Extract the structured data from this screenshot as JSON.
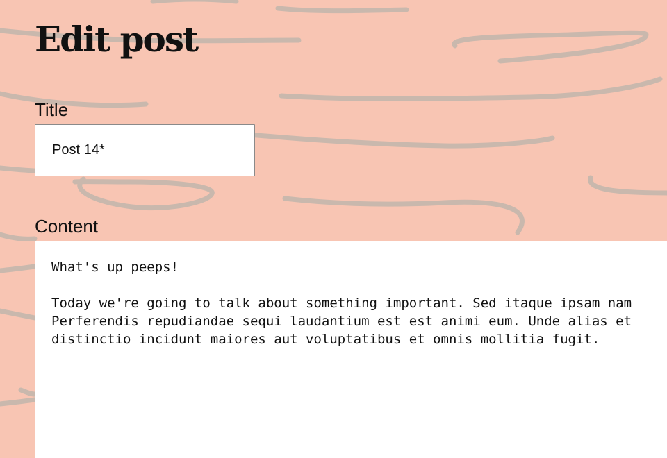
{
  "page": {
    "title": "Edit post"
  },
  "form": {
    "title_label": "Title",
    "title_value": "Post 14*",
    "content_label": "Content",
    "content_value": "What's up peeps!\n\nToday we're going to talk about something important. Sed itaque ipsam nam\nPerferendis repudiandae sequi laudantium est est animi eum. Unde alias et\ndistinctio incidunt maiores aut voluptatibus et omnis mollitia fugit."
  },
  "colors": {
    "background": "#f8c5b3",
    "squiggle": "#c9b8ad",
    "field_background": "#ffffff",
    "field_border": "#8a8a8a",
    "text": "#111111"
  }
}
